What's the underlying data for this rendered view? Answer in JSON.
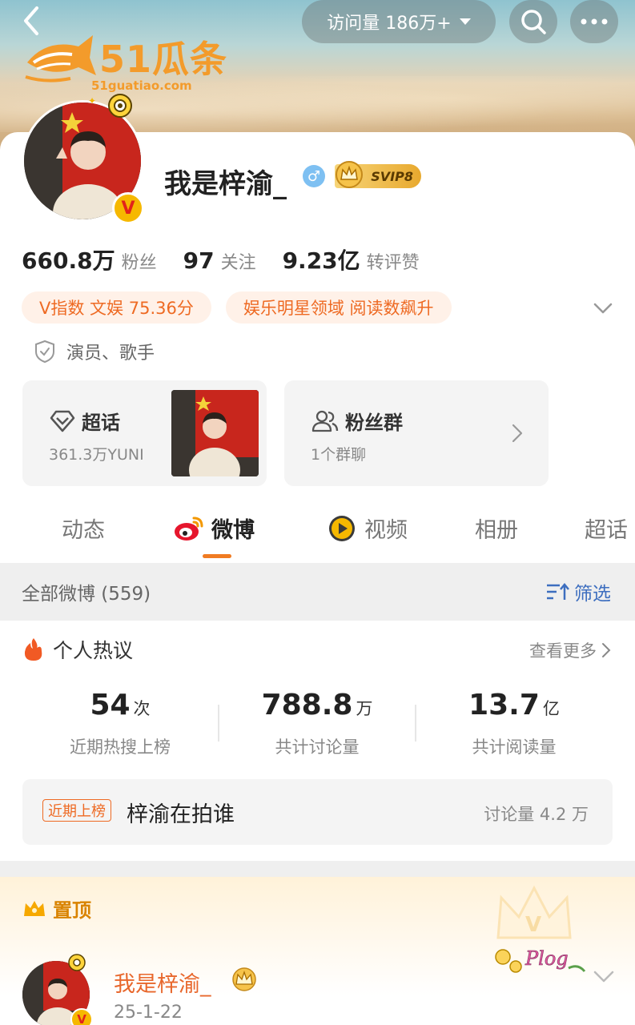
{
  "header": {
    "visits_label": "访问量 186万+"
  },
  "watermark": {
    "text": "51瓜条",
    "url": "51guatiao.com"
  },
  "profile": {
    "name": "我是梓渝_",
    "svip_label": "SVIP8",
    "stats": [
      {
        "value": "660.8万",
        "label": "粉丝"
      },
      {
        "value": "97",
        "label": "关注"
      },
      {
        "value": "9.23亿",
        "label": "转评赞"
      }
    ],
    "tags": [
      "V指数 文娱 75.36分",
      "娱乐明星领域 阅读数飙升"
    ],
    "role": "演员、歌手",
    "supertopic": {
      "title": "超话",
      "sub": "361.3万YUNI"
    },
    "fan_group": {
      "title": "粉丝群",
      "sub": "1个群聊"
    }
  },
  "tabs": [
    "动态",
    "微博",
    "视频",
    "相册",
    "超话"
  ],
  "active_tab": "微博",
  "filter": {
    "count_label": "全部微博 (559)",
    "filter_label": "筛选"
  },
  "hot": {
    "title": "个人热议",
    "see_more": "查看更多",
    "stats": [
      {
        "value": "54",
        "unit": "次",
        "label": "近期热搜上榜"
      },
      {
        "value": "788.8",
        "unit": "万",
        "label": "共计讨论量"
      },
      {
        "value": "13.7",
        "unit": "亿",
        "label": "共计阅读量"
      }
    ],
    "row": {
      "badge": "近期上榜",
      "topic": "梓渝在拍谁",
      "discussion": "讨论量 4.2 万"
    }
  },
  "pinned": {
    "label": "置顶",
    "post_name": "我是梓渝_",
    "post_date": "25-1-22",
    "plog_text": "Plog"
  },
  "colors": {
    "accent_orange": "#ee6a23",
    "tab_underline": "#f07b22",
    "filter_blue": "#3d6ebf",
    "verify_gold": "#f6b800"
  }
}
